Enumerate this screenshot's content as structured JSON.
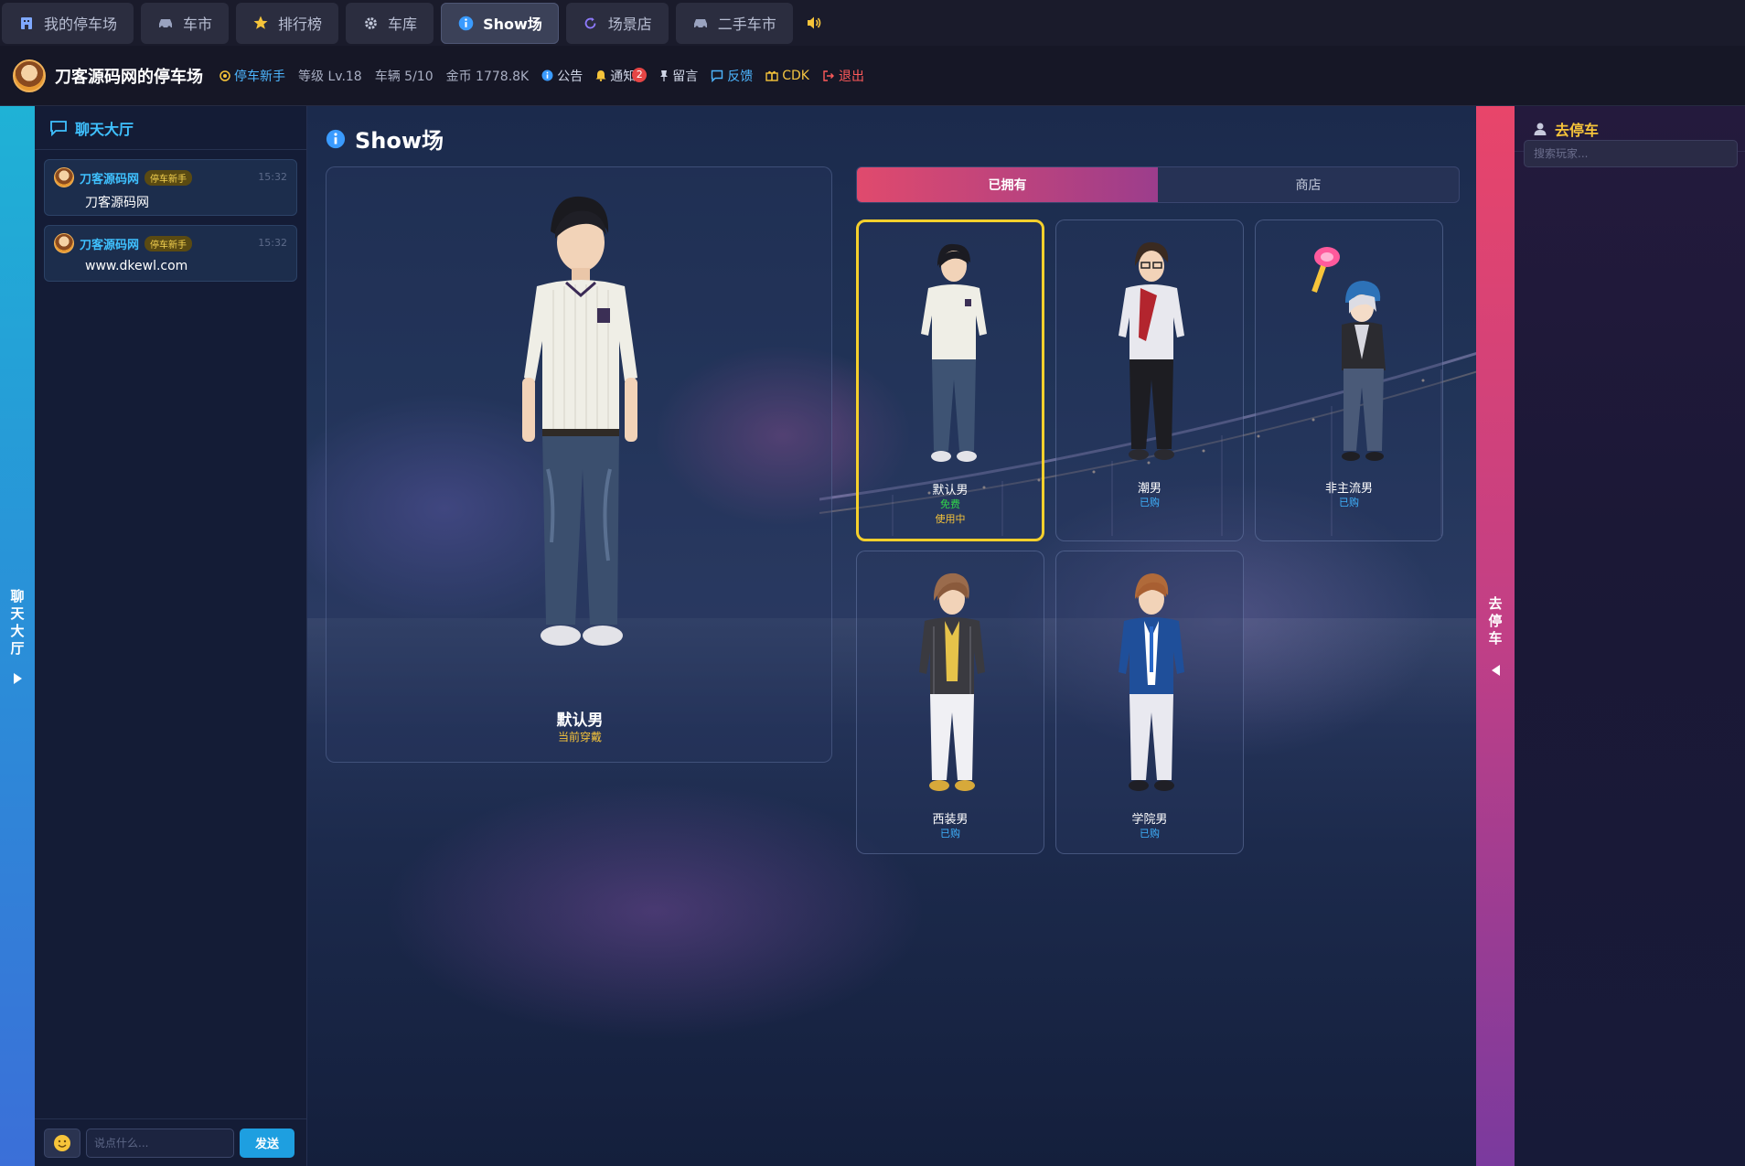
{
  "nav": {
    "tabs": [
      {
        "label": "我的停车场",
        "icon": "building-icon"
      },
      {
        "label": "车市",
        "icon": "car-icon"
      },
      {
        "label": "排行榜",
        "icon": "star-icon"
      },
      {
        "label": "车库",
        "icon": "gear-icon"
      },
      {
        "label": "Show场",
        "icon": "info-icon",
        "active": true
      },
      {
        "label": "场景店",
        "icon": "refresh-icon"
      },
      {
        "label": "二手车市",
        "icon": "car-icon"
      }
    ],
    "sound_icon": "speaker-icon"
  },
  "info": {
    "title": "刀客源码网的停车场",
    "rank": "停车新手",
    "level": "等级 Lv.18",
    "cars": "车辆 5/10",
    "coins": "金币 1778.8K",
    "notice": "公告",
    "notify": "通知",
    "notify_count": "2",
    "message": "留言",
    "feedback": "反馈",
    "cdk": "CDK",
    "logout": "退出"
  },
  "chat": {
    "edge_label": "聊天大厅",
    "title": "聊天大厅",
    "messages": [
      {
        "user": "刀客源码网",
        "badge": "停车新手",
        "time": "15:32",
        "text": "刀客源码网"
      },
      {
        "user": "刀客源码网",
        "badge": "停车新手",
        "time": "15:32",
        "text": "www.dkewl.com"
      }
    ],
    "input_placeholder": "说点什么...",
    "send_label": "发送"
  },
  "show": {
    "title": "Show场",
    "preview_name": "默认男",
    "preview_status": "当前穿戴",
    "tabs": [
      {
        "label": "已拥有",
        "active": true
      },
      {
        "label": "商店",
        "active": false
      }
    ],
    "outfits": [
      {
        "name": "默认男",
        "price": "免费",
        "state": "使用中",
        "selected": true
      },
      {
        "name": "潮男",
        "owned": "已购"
      },
      {
        "name": "非主流男",
        "owned": "已购"
      },
      {
        "name": "西装男",
        "owned": "已购"
      },
      {
        "name": "学院男",
        "owned": "已购"
      }
    ]
  },
  "park": {
    "edge_label": "去停车",
    "title": "去停车",
    "search_placeholder": "搜索玩家..."
  },
  "colors": {
    "accent_blue": "#3fc1ff",
    "accent_gold": "#f6c43a",
    "accent_pink": "#e04a6d",
    "selected_border": "#f6d02c"
  }
}
